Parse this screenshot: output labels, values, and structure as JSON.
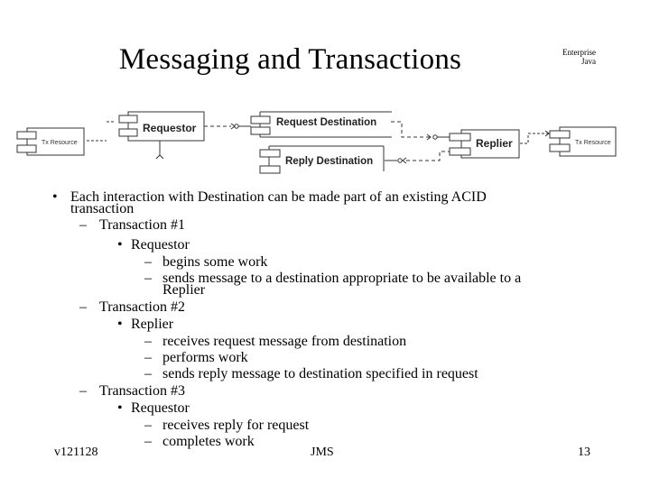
{
  "slide": {
    "title": "Messaging and Transactions",
    "brand_line1": "Enterprise",
    "brand_line2": "Java"
  },
  "diagram": {
    "components": {
      "tx_resource_left": "Tx Resource",
      "requestor": "Requestor",
      "request_destination": "Request Destination",
      "reply_destination": "Reply Destination",
      "replier": "Replier",
      "tx_resource_right": "Tx Resource"
    }
  },
  "bullets": [
    {
      "level": 0,
      "marker": "•",
      "text": "Each interaction with Destination can be made part of an existing ACID"
    },
    {
      "level": 0,
      "marker": "",
      "text": "transaction"
    },
    {
      "level": 1,
      "marker": "–",
      "text": "Transaction #1"
    },
    {
      "level": 2,
      "marker": "•",
      "text": "Requestor"
    },
    {
      "level": 3,
      "marker": "–",
      "text": "begins some work"
    },
    {
      "level": 3,
      "marker": "–",
      "text": "sends message to a destination appropriate to be available to a"
    },
    {
      "level": 3,
      "marker": "",
      "text": "Replier"
    },
    {
      "level": 1,
      "marker": "–",
      "text": "Transaction #2"
    },
    {
      "level": 2,
      "marker": "•",
      "text": "Replier"
    },
    {
      "level": 3,
      "marker": "–",
      "text": "receives request message from destination"
    },
    {
      "level": 3,
      "marker": "–",
      "text": "performs work"
    },
    {
      "level": 3,
      "marker": "–",
      "text": "sends reply message to destination specified in request"
    },
    {
      "level": 1,
      "marker": "–",
      "text": "Transaction #3"
    },
    {
      "level": 2,
      "marker": "•",
      "text": "Requestor"
    },
    {
      "level": 3,
      "marker": "–",
      "text": "receives reply for request"
    },
    {
      "level": 3,
      "marker": "–",
      "text": "completes work"
    }
  ],
  "footer": {
    "version": "v121128",
    "topic": "JMS",
    "page": "13"
  }
}
